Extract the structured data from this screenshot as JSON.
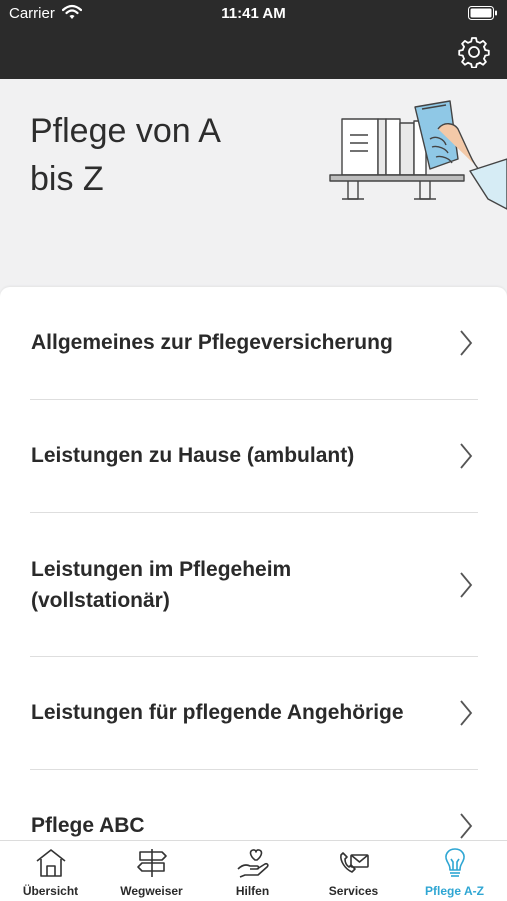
{
  "status_bar": {
    "carrier": "Carrier",
    "time": "11:41 AM"
  },
  "header": {
    "settings_icon": "gear-icon"
  },
  "hero": {
    "title": "Pflege von A bis Z",
    "illustration": "bookshelf-hand-illustration"
  },
  "list": {
    "items": [
      {
        "label": "Allgemeines zur Pflegeversicherung"
      },
      {
        "label": "Leistungen zu Hause (ambulant)"
      },
      {
        "label": "Leistungen im Pflegeheim (vollstationär)"
      },
      {
        "label": "Leistungen für pflegende Angehörige"
      },
      {
        "label": "Pflege ABC"
      }
    ]
  },
  "tabs": [
    {
      "label": "Übersicht",
      "icon": "house-icon"
    },
    {
      "label": "Wegweiser",
      "icon": "signpost-icon"
    },
    {
      "label": "Hilfen",
      "icon": "heart-hand-icon"
    },
    {
      "label": "Services",
      "icon": "phone-mail-icon"
    },
    {
      "label": "Pflege A-Z",
      "icon": "lightbulb-icon",
      "active": true
    }
  ],
  "colors": {
    "accent": "#2fa6d3",
    "topbar": "#2b2b2b",
    "hero_bg": "#f1f1f2"
  }
}
